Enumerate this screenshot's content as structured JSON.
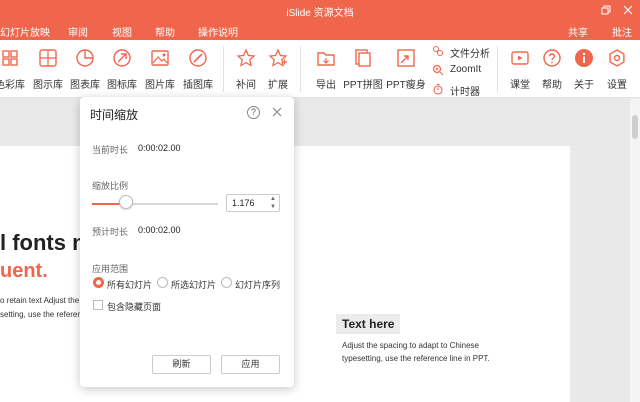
{
  "titlebar": {
    "title": "iSlide 资源文档",
    "restore_icon": "restore-icon",
    "close_icon": "close-icon"
  },
  "menu": {
    "items": [
      "幻灯片放映",
      "审阅",
      "视图",
      "帮助",
      "操作说明"
    ],
    "right_items": [
      "共享",
      "批注"
    ]
  },
  "ribbon": {
    "tools": [
      {
        "label": "色彩库",
        "icon": "palette-icon"
      },
      {
        "label": "图示库",
        "icon": "grid-diagram-icon"
      },
      {
        "label": "图表库",
        "icon": "pie-chart-icon"
      },
      {
        "label": "图标库",
        "icon": "rocket-icon"
      },
      {
        "label": "图片库",
        "icon": "image-icon"
      },
      {
        "label": "插图库",
        "icon": "brush-icon"
      },
      {
        "label": "补间",
        "icon": "star-tween-icon"
      },
      {
        "label": "扩展",
        "icon": "star-extend-icon"
      },
      {
        "label": "导出",
        "icon": "folder-export-icon"
      },
      {
        "label": "PPT拼图",
        "icon": "collage-icon"
      },
      {
        "label": "PPT瘦身",
        "icon": "compress-icon"
      },
      {
        "label": "课堂",
        "icon": "video-class-icon"
      },
      {
        "label": "帮助",
        "icon": "help-icon"
      },
      {
        "label": "关于",
        "icon": "info-icon"
      },
      {
        "label": "设置",
        "icon": "gear-icon"
      }
    ],
    "small_tools": [
      {
        "label": "文件分析",
        "icon": "file-analysis-icon"
      },
      {
        "label": "ZoomIt",
        "icon": "zoom-icon"
      },
      {
        "label": "计时器",
        "icon": "timer-icon"
      }
    ]
  },
  "slide": {
    "heading_line1": "l fonts n",
    "heading_line2": "uent.",
    "left_text_1": "o retain text Adjust the s",
    "left_text_2": "setting, use the reference l",
    "text_box": "Text here",
    "para_1": "Adjust the spacing to adapt to Chinese",
    "para_2": "typesetting, use the reference line in PPT."
  },
  "dialog": {
    "title": "时间缩放",
    "current_duration_label": "当前时长",
    "current_duration": "0:00:02.00",
    "scale_label": "缩放比例",
    "scale_value": "1.176",
    "slider_level": 0.27,
    "estimated_label": "预计时长",
    "estimated_duration": "0:00:02.00",
    "range_label": "应用范围",
    "range_options": [
      "所有幻灯片",
      "所选幻灯片",
      "幻灯片序列"
    ],
    "range_selected": "所有幻灯片",
    "include_hidden_label": "包含隐藏页面",
    "refresh_button": "刷新",
    "apply_button": "应用"
  },
  "colors": {
    "accent": "#f0664d"
  }
}
